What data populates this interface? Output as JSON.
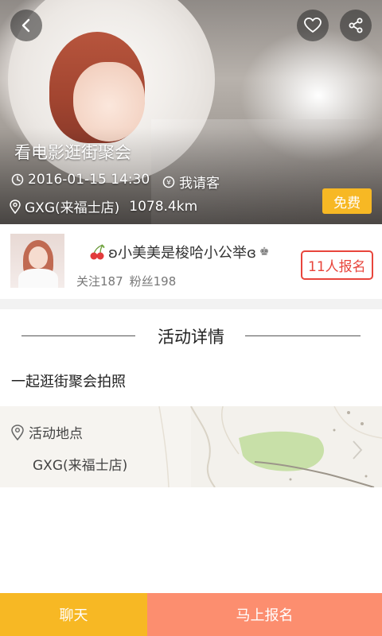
{
  "event": {
    "title": "看电影逛街聚会",
    "datetime": "2016-01-15 14:30",
    "payment": "我请客",
    "location": "GXG(来福士店)",
    "distance": "1078.4km",
    "price_badge": "免费"
  },
  "organizer": {
    "name": "ʚ小美美是梭哈小公举ɞ",
    "name_prefix_icon": "cherry-icon",
    "name_suffix": "♚",
    "follow_label": "关注187",
    "fans_label": "粉丝198",
    "signup_count_label": "11人报名"
  },
  "details": {
    "section_title": "活动详情",
    "description": "一起逛街聚会拍照"
  },
  "map": {
    "label": "活动地点",
    "address": "GXG(来福士店)"
  },
  "actions": {
    "chat_label": "聊天",
    "join_label": "马上报名"
  },
  "colors": {
    "accent_yellow": "#f7b824",
    "accent_salmon": "#fc8e6f",
    "signup_red": "#e8453c"
  }
}
